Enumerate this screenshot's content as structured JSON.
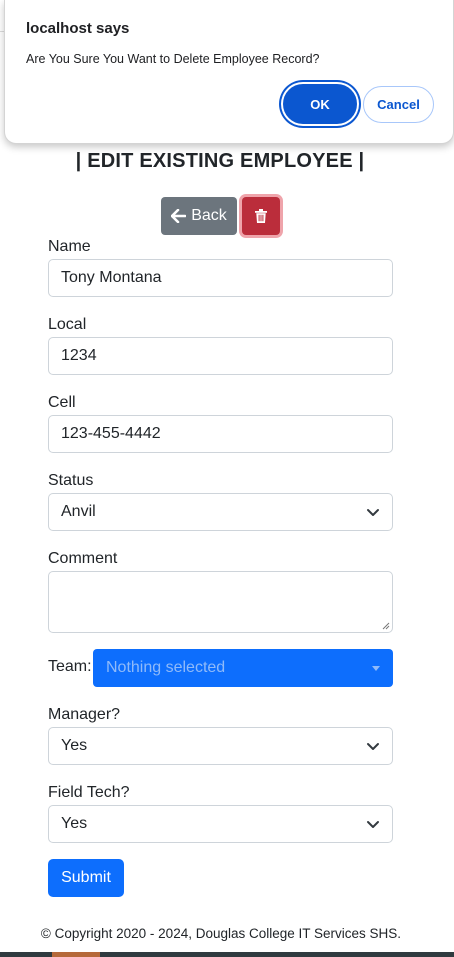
{
  "dialog": {
    "title": "localhost says",
    "message": "Are You Sure You Want to Delete Employee Record?",
    "ok_label": "OK",
    "cancel_label": "Cancel"
  },
  "page": {
    "heading": "| EDIT EXISTING EMPLOYEE |"
  },
  "actions": {
    "back_label": "Back",
    "back_icon": "arrow-left-icon",
    "delete_icon": "trash-icon"
  },
  "form": {
    "name": {
      "label": "Name",
      "value": "Tony Montana"
    },
    "local": {
      "label": "Local",
      "value": "1234"
    },
    "cell": {
      "label": "Cell",
      "value": "123-455-4442"
    },
    "status": {
      "label": "Status",
      "value": "Anvil"
    },
    "comment": {
      "label": "Comment",
      "value": ""
    },
    "team": {
      "label": "Team:",
      "placeholder": "Nothing selected"
    },
    "manager": {
      "label": "Manager?",
      "value": "Yes"
    },
    "field_tech": {
      "label": "Field Tech?",
      "value": "Yes"
    },
    "submit_label": "Submit"
  },
  "footer": {
    "copyright": "© Copyright 2020 - 2024, Douglas College IT Services SHS."
  },
  "colors": {
    "primary": "#0d6efd",
    "secondary": "#6c757d",
    "danger": "#bb2d3b",
    "dialog_accent": "#0b57d0"
  }
}
